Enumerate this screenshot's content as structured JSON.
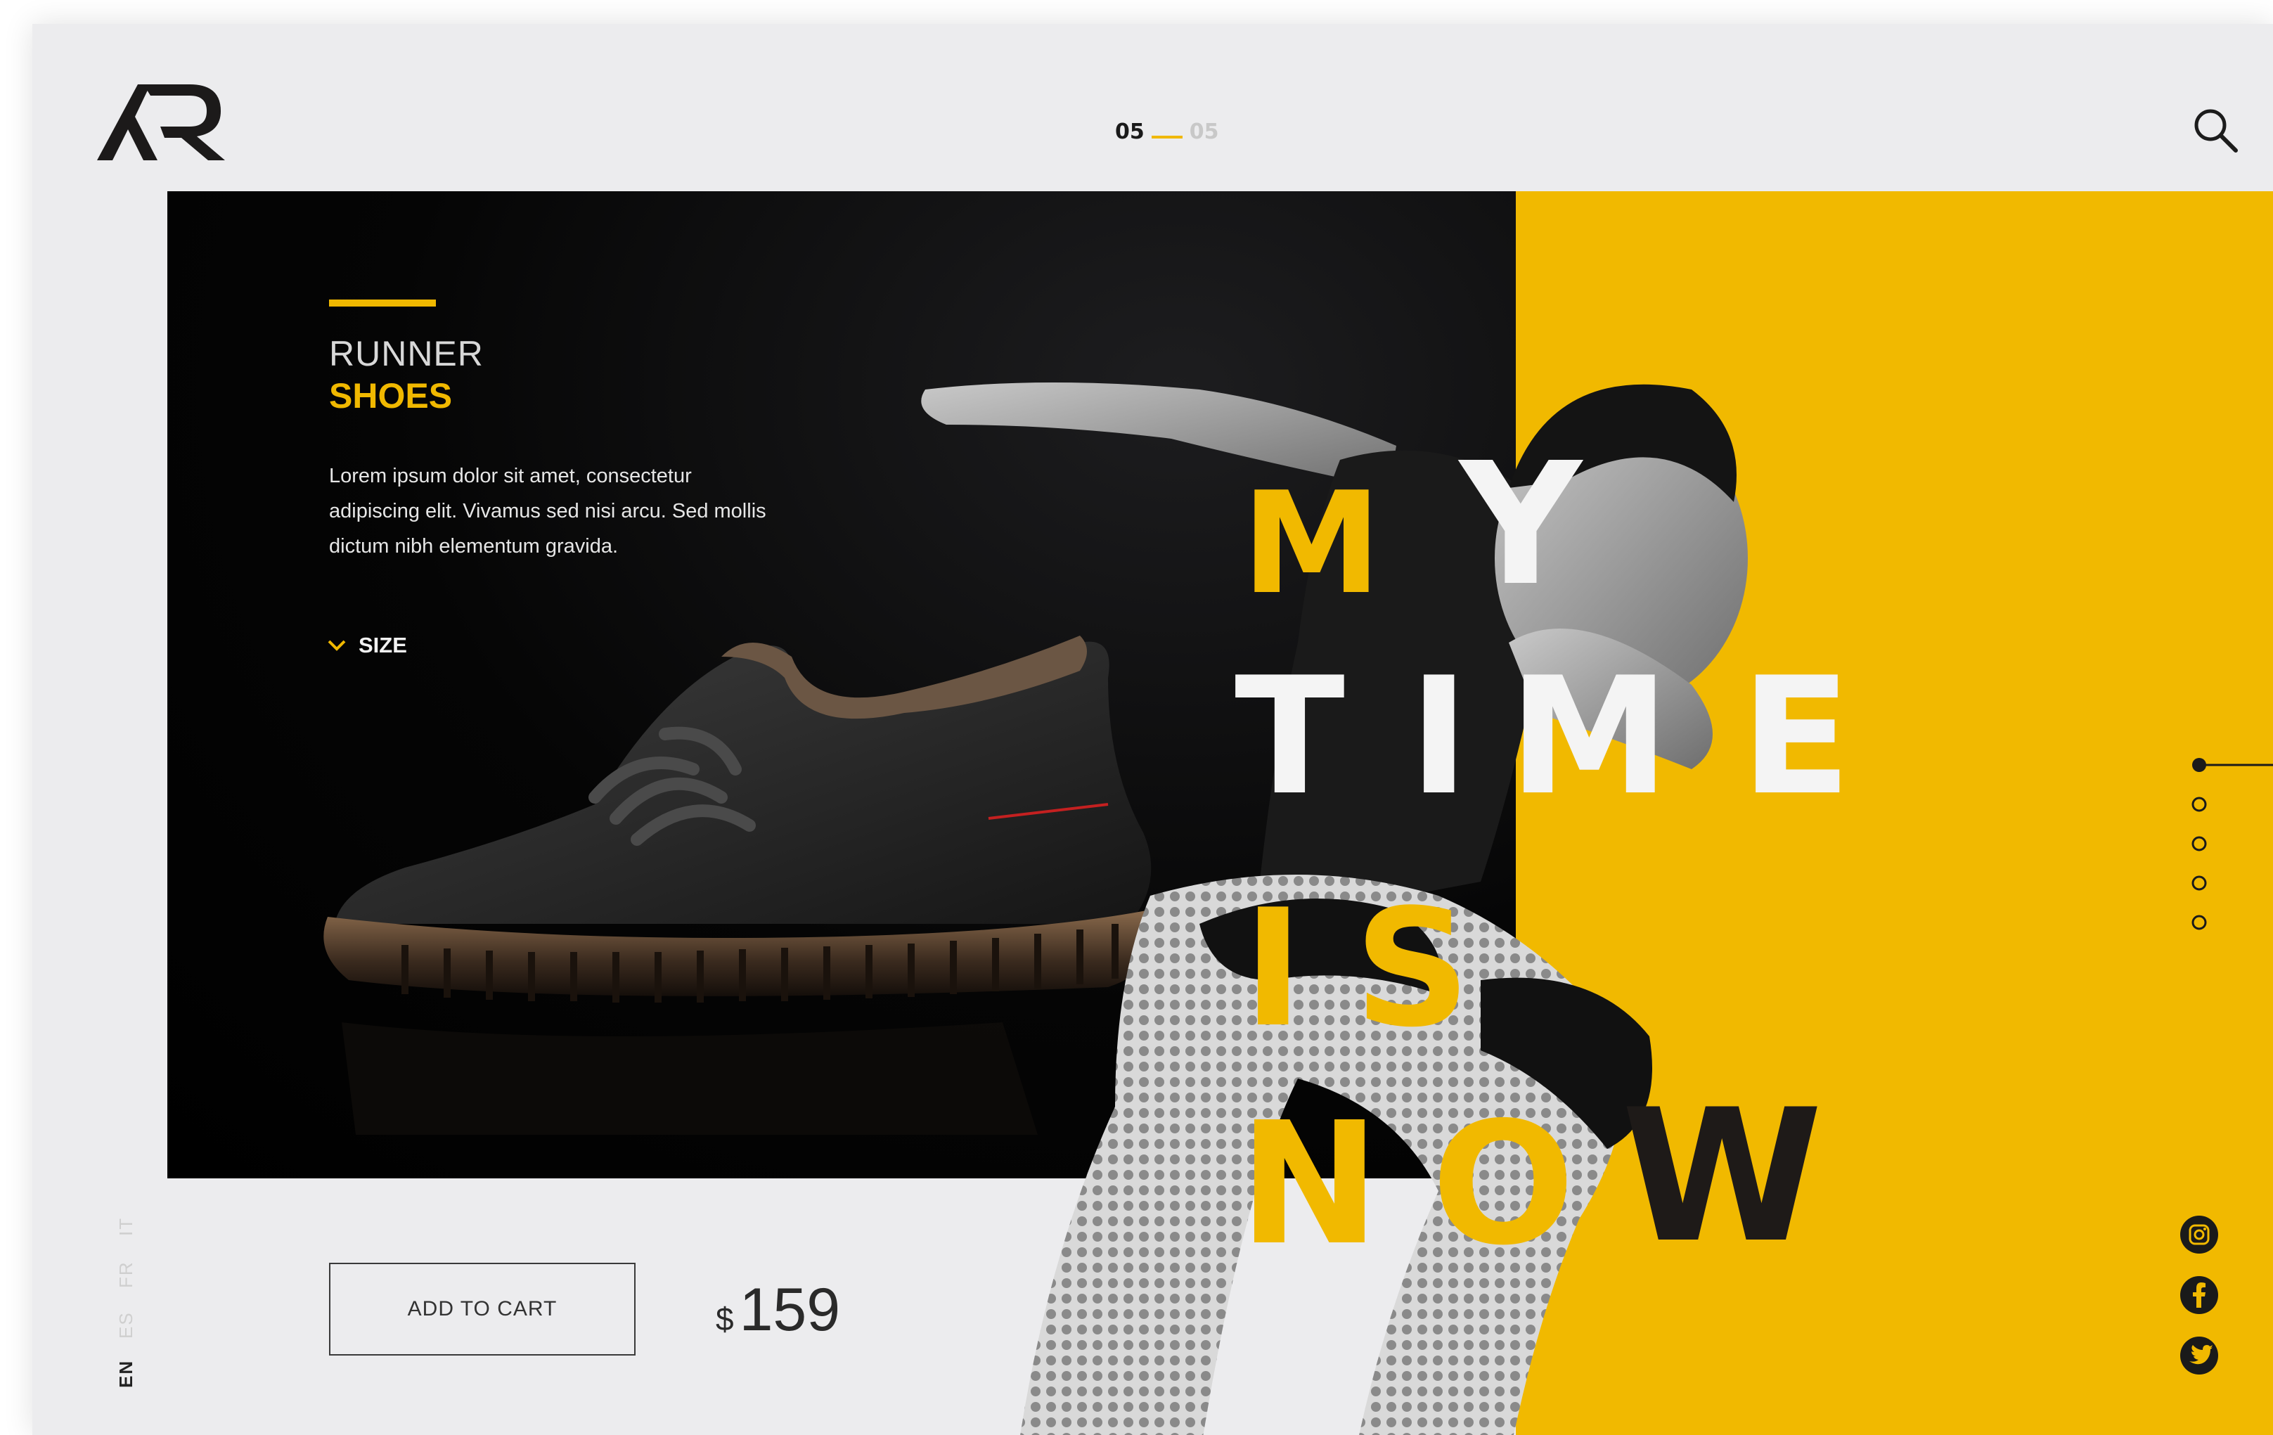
{
  "header": {
    "logo_text": "AR",
    "pager": {
      "current": "05",
      "total": "05"
    }
  },
  "product": {
    "title_line1": "RUNNER",
    "title_line2": "SHOES",
    "description": "Lorem ipsum dolor sit amet, consectetur adipiscing elit. Vivamus sed nisi arcu. Sed mollis dictum nibh elementum gravida.",
    "size_label": "SIZE",
    "add_to_cart_label": "ADD TO CART",
    "price_currency": "$",
    "price_amount": "159"
  },
  "headline": {
    "letters": [
      "M",
      "Y",
      "T",
      "I",
      "M",
      "E",
      "I",
      "S",
      "N",
      "O",
      "W"
    ]
  },
  "languages": [
    "EN",
    "ES",
    "FR",
    "IT"
  ],
  "active_language": "EN",
  "slider": {
    "total": 5,
    "active_index": 0
  },
  "social": [
    "instagram-icon",
    "facebook-icon",
    "twitter-icon"
  ],
  "colors": {
    "accent": "#f1b900",
    "dark": "#000000",
    "background": "#ececee"
  }
}
